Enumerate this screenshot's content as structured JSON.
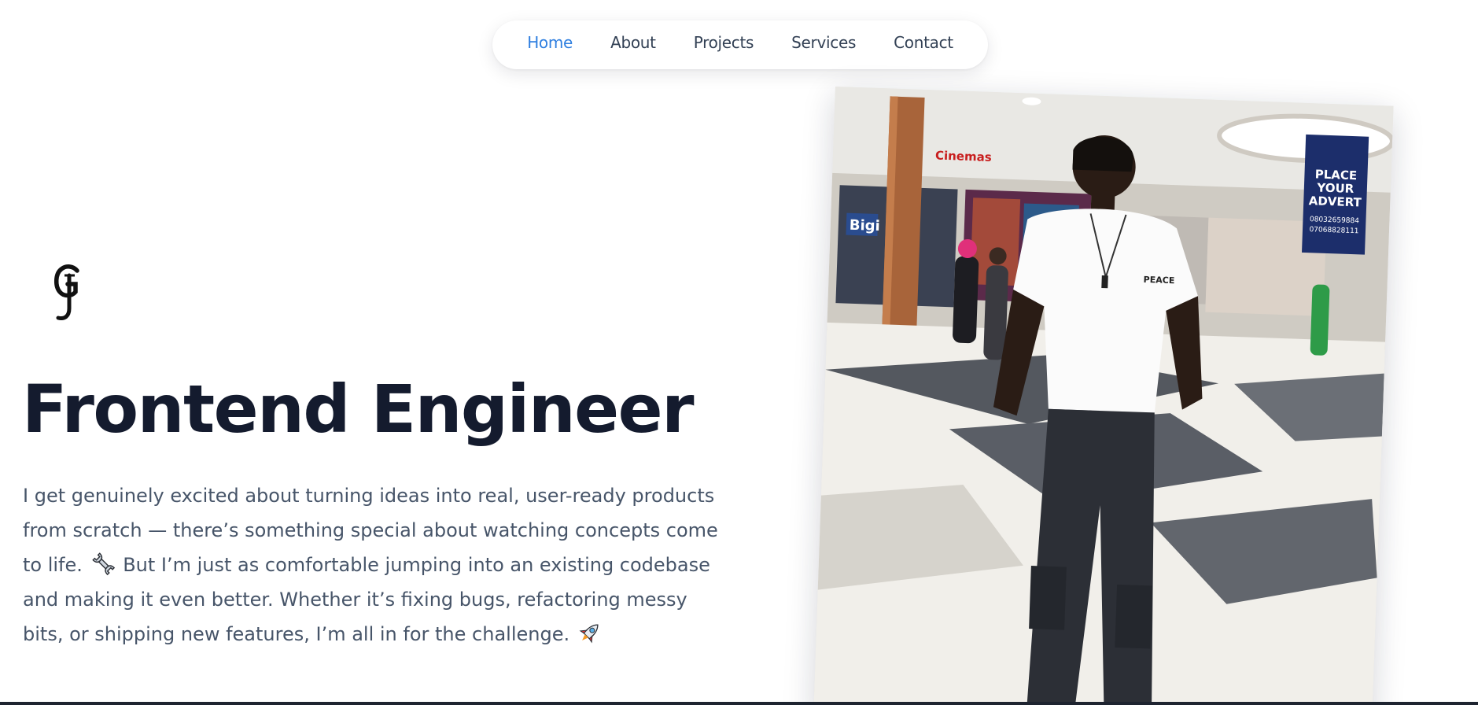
{
  "nav": {
    "items": [
      {
        "label": "Home",
        "active": true
      },
      {
        "label": "About",
        "active": false
      },
      {
        "label": "Projects",
        "active": false
      },
      {
        "label": "Services",
        "active": false
      },
      {
        "label": "Contact",
        "active": false
      }
    ]
  },
  "hero": {
    "logo_icon": "gj-monogram-logo",
    "title": "Frontend Engineer",
    "bio_part1": "I get genuinely excited about turning ideas into real, user-ready products from scratch — there’s something special about watching concepts come to life.",
    "bio_emoji1": "wrench-emoji",
    "bio_part2": "But I’m just as comfortable jumping into an existing codebase and making it even better. Whether it’s fixing bugs, refactoring messy bits, or shipping new features, I’m all in for the challenge.",
    "bio_emoji2": "rocket-emoji"
  },
  "photo": {
    "shirt_text": "PEACE",
    "cinema_sign": "Cinemas",
    "brand_sign": "Bigi",
    "advert_line1": "PLACE",
    "advert_line2": "YOUR",
    "advert_line3": "ADVERT",
    "advert_phone1": "08032659884",
    "advert_phone2": "07068828111"
  },
  "colors": {
    "accent": "#2f7fe0",
    "heading": "#141b2e",
    "body_text": "#475569",
    "nav_text": "#334155"
  }
}
